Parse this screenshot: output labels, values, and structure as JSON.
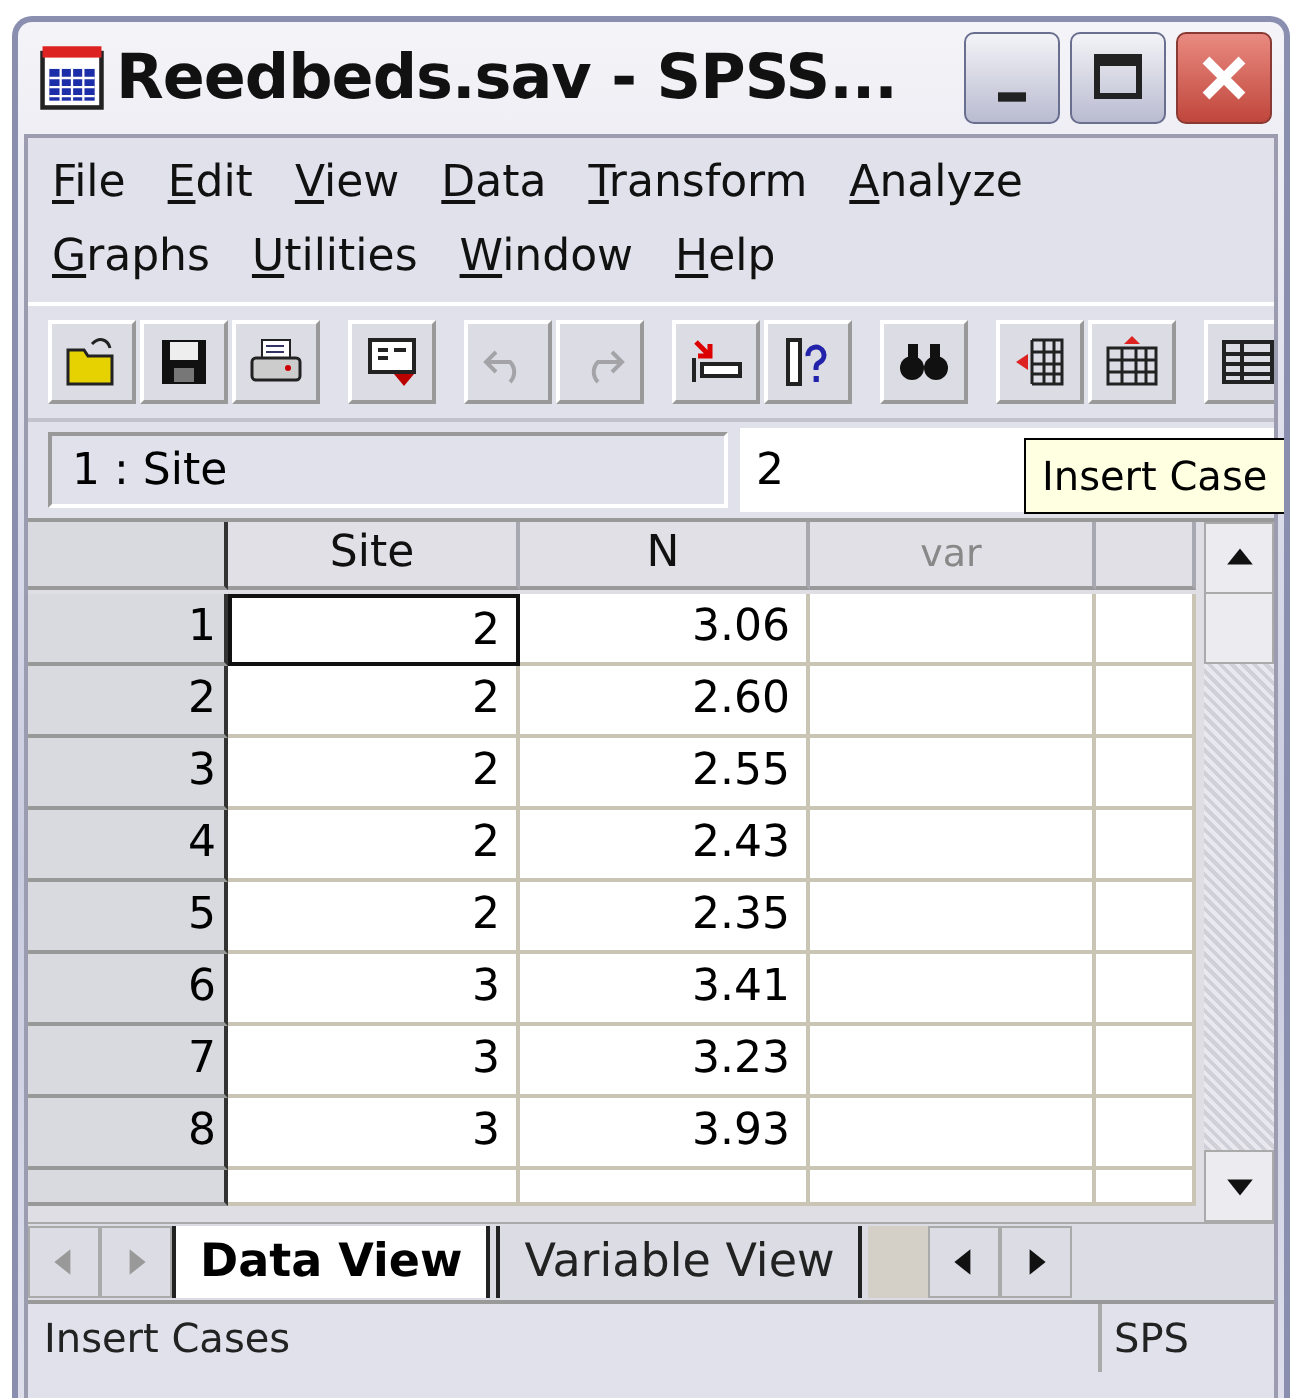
{
  "window": {
    "title": "Reedbeds.sav - SPSS..."
  },
  "menu_rows": [
    [
      "File",
      "Edit",
      "View",
      "Data",
      "Transform",
      "Analyze"
    ],
    [
      "Graphs",
      "Utilities",
      "Window",
      "Help"
    ]
  ],
  "toolbar": [
    {
      "kind": "open",
      "disabled": false
    },
    {
      "kind": "save",
      "disabled": false
    },
    {
      "kind": "print",
      "disabled": false
    },
    {
      "kind": "dialog",
      "disabled": false
    },
    {
      "kind": "undo",
      "disabled": true
    },
    {
      "kind": "redo",
      "disabled": true
    },
    {
      "kind": "goto",
      "disabled": false
    },
    {
      "kind": "varinfo",
      "disabled": false
    },
    {
      "kind": "find",
      "disabled": false
    },
    {
      "kind": "insert-cases",
      "disabled": false
    },
    {
      "kind": "insert-var",
      "disabled": false
    },
    {
      "kind": "split",
      "disabled": false
    }
  ],
  "cell_editor": {
    "cell_ref": "1 : Site",
    "value": "2"
  },
  "tooltip": "Insert Case",
  "grid": {
    "columns": [
      {
        "label": "Site",
        "empty": false
      },
      {
        "label": "N",
        "empty": false
      },
      {
        "label": "var",
        "empty": true
      }
    ],
    "rows": [
      {
        "num": "1",
        "cells": [
          "2",
          "3.06"
        ],
        "selected": [
          true,
          false
        ]
      },
      {
        "num": "2",
        "cells": [
          "2",
          "2.60"
        ],
        "selected": [
          false,
          false
        ]
      },
      {
        "num": "3",
        "cells": [
          "2",
          "2.55"
        ],
        "selected": [
          false,
          false
        ]
      },
      {
        "num": "4",
        "cells": [
          "2",
          "2.43"
        ],
        "selected": [
          false,
          false
        ]
      },
      {
        "num": "5",
        "cells": [
          "2",
          "2.35"
        ],
        "selected": [
          false,
          false
        ]
      },
      {
        "num": "6",
        "cells": [
          "3",
          "3.41"
        ],
        "selected": [
          false,
          false
        ]
      },
      {
        "num": "7",
        "cells": [
          "3",
          "3.23"
        ],
        "selected": [
          false,
          false
        ]
      },
      {
        "num": "8",
        "cells": [
          "3",
          "3.93"
        ],
        "selected": [
          false,
          false
        ]
      }
    ]
  },
  "tabs": [
    {
      "label": "Data View",
      "selected": true
    },
    {
      "label": "Variable View",
      "selected": false
    }
  ],
  "status_bar": {
    "message": "Insert Cases",
    "processor": "SPS"
  }
}
